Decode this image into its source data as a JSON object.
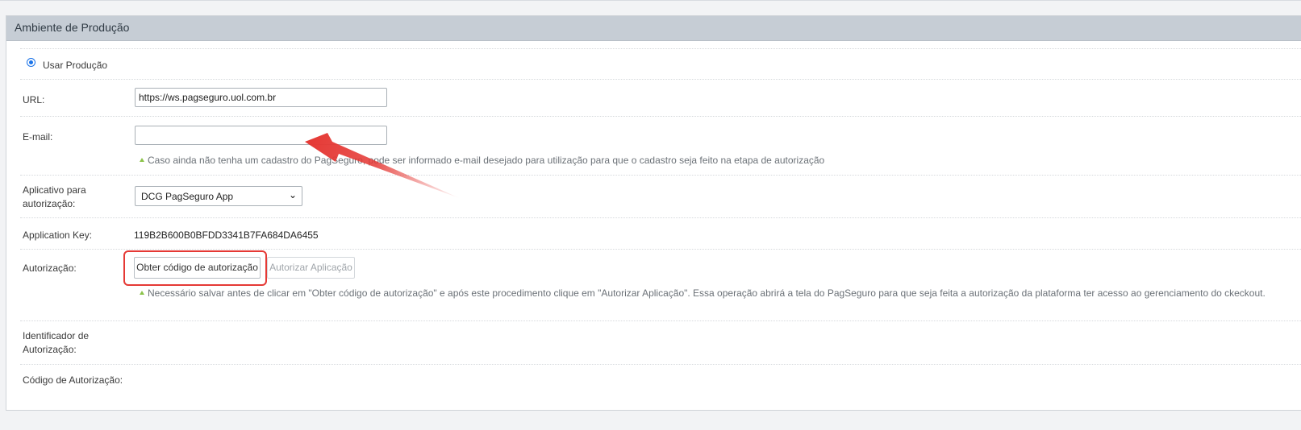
{
  "panel": {
    "title": "Ambiente de Produção"
  },
  "radio": {
    "label": "Usar Produção",
    "checked": true
  },
  "url": {
    "label": "URL:",
    "value": "https://ws.pagseguro.uol.com.br"
  },
  "email": {
    "label": "E-mail:",
    "value": "",
    "hint": "Caso ainda não tenha um cadastro do PagSeguro, pode ser informado e-mail desejado para utilização para que o cadastro seja feito na etapa de autorização"
  },
  "app": {
    "label_line1": "Aplicativo para",
    "label_line2": "autorização:",
    "selected": "DCG PagSeguro App"
  },
  "app_key": {
    "label": "Application Key:",
    "value": "119B2B600B0BFDD3341B7FA684DA6455"
  },
  "auth": {
    "label": "Autorização:",
    "get_code_button": "Obter código de autorização",
    "authorize_button": "Autorizar Aplicação",
    "hint": "Necessário salvar antes de clicar em \"Obter código de autorização\" e após este procedimento clique em \"Autorizar Aplicação\". Essa operação abrirá a tela do PagSeguro para que seja feita a autorização da plataforma ter acesso ao gerenciamento do ckeckout."
  },
  "auth_id": {
    "label_line1": "Identificador de",
    "label_line2": "Autorização:"
  },
  "auth_code": {
    "label": "Código de Autorização:"
  },
  "colors": {
    "header_bg": "#c6cdd5",
    "radio": "#1a73e8",
    "hint_icon": "#8bc34a",
    "annotation": "#e53935"
  },
  "icons": {
    "hint": "triangle-up-icon",
    "select": "chevron-down-icon",
    "annotation": "red-arrow-icon"
  }
}
